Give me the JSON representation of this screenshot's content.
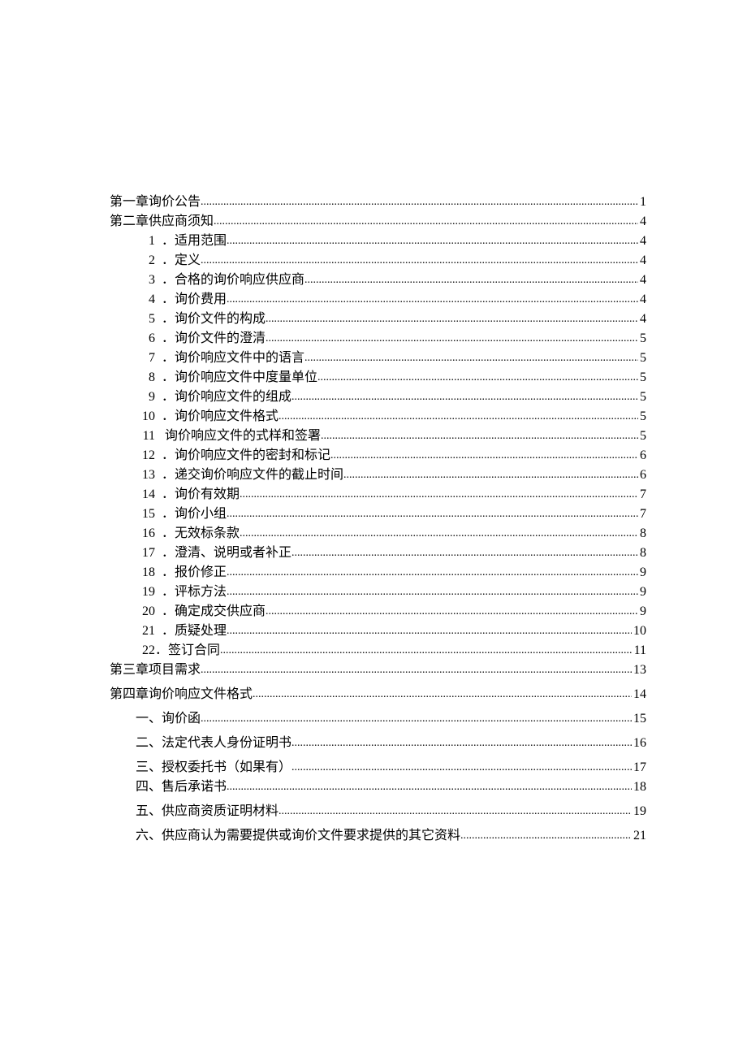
{
  "toc": [
    {
      "level": 0,
      "label": "第一章询价公告",
      "page": "1",
      "spaced": false
    },
    {
      "level": 0,
      "label": "第二章供应商须知",
      "page": "4",
      "spaced": false
    },
    {
      "level": 1,
      "num": "1",
      "label": "．适用范围",
      "page": "4",
      "spaced": false
    },
    {
      "level": 1,
      "num": "2",
      "label": "．定义",
      "page": "4",
      "spaced": false
    },
    {
      "level": 1,
      "num": "3",
      "label": "．合格的询价响应供应商",
      "page": "4",
      "spaced": false
    },
    {
      "level": 1,
      "num": "4",
      "label": "．询价费用",
      "page": "4",
      "spaced": false
    },
    {
      "level": 1,
      "num": "5",
      "label": "．询价文件的构成",
      "page": "4",
      "spaced": false
    },
    {
      "level": 1,
      "num": "6",
      "label": "．询价文件的澄清",
      "page": "5",
      "spaced": false
    },
    {
      "level": 1,
      "num": "7",
      "label": "．询价响应文件中的语言",
      "page": "5",
      "spaced": false
    },
    {
      "level": 1,
      "num": "8",
      "label": "．询价响应文件中度量单位",
      "page": "5",
      "spaced": false
    },
    {
      "level": 1,
      "num": "9",
      "label": "．询价响应文件的组成",
      "page": "5",
      "spaced": false
    },
    {
      "level": 1,
      "num": "10",
      "label": "．询价响应文件格式",
      "page": "5",
      "spaced": false
    },
    {
      "level": 1,
      "num": "11",
      "label": " 询价响应文件的式样和签署",
      "page": "5",
      "spaced": false
    },
    {
      "level": 1,
      "num": "12",
      "label": "．询价响应文件的密封和标记",
      "page": "6",
      "spaced": false
    },
    {
      "level": 1,
      "num": "13",
      "label": "．递交询价响应文件的截止时间",
      "page": "6",
      "spaced": false
    },
    {
      "level": 1,
      "num": "14",
      "label": "．询价有效期",
      "page": "7",
      "spaced": false
    },
    {
      "level": 1,
      "num": "15",
      "label": "．询价小组",
      "page": "7",
      "spaced": false
    },
    {
      "level": 1,
      "num": "16",
      "label": "．无效标条款",
      "page": "8",
      "spaced": false
    },
    {
      "level": 1,
      "num": "17",
      "label": "．澄清、说明或者补正",
      "page": "8",
      "spaced": false
    },
    {
      "level": 1,
      "num": "18",
      "label": "．报价修正",
      "page": "9",
      "spaced": false
    },
    {
      "level": 1,
      "num": "19",
      "label": "．评标方法",
      "page": "9",
      "spaced": false
    },
    {
      "level": 1,
      "num": "20",
      "label": "．确定成交供应商",
      "page": "9",
      "spaced": false
    },
    {
      "level": 1,
      "num": "21",
      "label": "．质疑处理",
      "page": "10",
      "spaced": false
    },
    {
      "level": 1,
      "num": "",
      "label": "22．签订合同",
      "page": "11",
      "spaced": false
    },
    {
      "level": 0,
      "label": "第三章项目需求",
      "page": "13",
      "spaced": true
    },
    {
      "level": 0,
      "label": "第四章询价响应文件格式",
      "page": "14",
      "spaced": true
    },
    {
      "level": 1,
      "label": "一、询价函",
      "page": "15",
      "spaced": true
    },
    {
      "level": 1,
      "label": "二、法定代表人身份证明书",
      "page": "16",
      "spaced": true
    },
    {
      "level": 1,
      "label": "三、授权委托书（如果有）",
      "page": "17",
      "spaced": false
    },
    {
      "level": 1,
      "label": "四、售后承诺书",
      "page": "18",
      "spaced": true
    },
    {
      "level": 1,
      "label": "五、供应商资质证明材料",
      "page": "19",
      "spaced": true
    },
    {
      "level": 1,
      "label": "六、供应商认为需要提供或询价文件要求提供的其它资料",
      "page": "21",
      "spaced": false
    }
  ]
}
